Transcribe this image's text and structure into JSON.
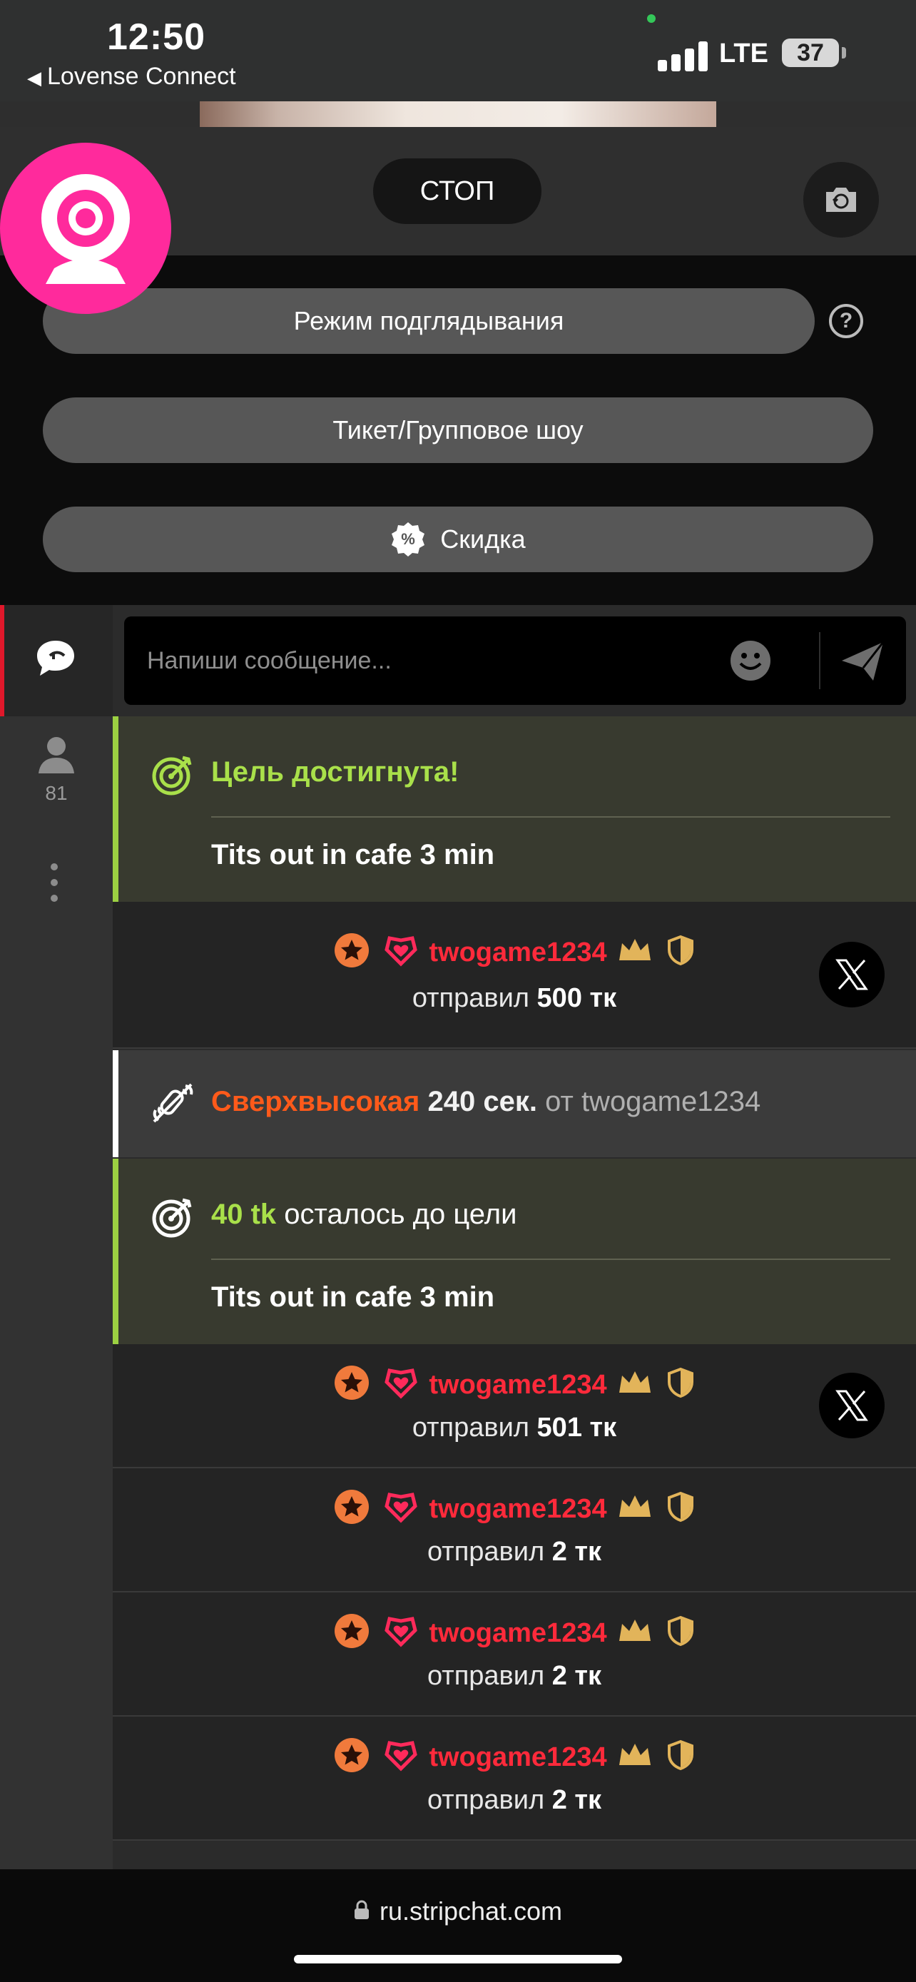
{
  "status_bar": {
    "time": "12:50",
    "back_label": "Lovense Connect",
    "network": "LTE",
    "battery": "37"
  },
  "controls": {
    "stop_label": "СТОП"
  },
  "options": {
    "peek_mode_label": "Режим подглядывания",
    "help_label": "?",
    "ticket_show_label": "Тикет/Групповое шоу",
    "discount_label": "Скидка",
    "discount_icon_text": "%"
  },
  "sidebar": {
    "user_count": "81"
  },
  "chat_input": {
    "placeholder": "Напиши сообщение..."
  },
  "messages": {
    "goal_reached": {
      "title": "Цель достигнута!",
      "goal_name": "Tits out in cafe 3 min"
    },
    "tip1": {
      "username": "twogame1234",
      "sent_label": "отправил",
      "amount": "500 тк"
    },
    "vibration": {
      "level": "Сверхвысокая",
      "duration": "240 сек.",
      "from_label": "от",
      "username": "twogame1234"
    },
    "goal_remaining": {
      "amount": "40 tk",
      "text": "осталось до цели",
      "goal_name": "Tits out in cafe 3 min"
    },
    "tip2": {
      "username": "twogame1234",
      "sent_label": "отправил",
      "amount": "501 тк"
    },
    "tip3": {
      "username": "twogame1234",
      "sent_label": "отправил",
      "amount": "2 тк"
    },
    "tip4": {
      "username": "twogame1234",
      "sent_label": "отправил",
      "amount": "2 тк"
    },
    "tip5": {
      "username": "twogame1234",
      "sent_label": "отправил",
      "amount": "2 тк"
    }
  },
  "url_bar": {
    "url": "ru.stripchat.com"
  },
  "colors": {
    "brand_pink": "#ff2a9c",
    "goal_lime": "#a9e04a",
    "username_red": "#ff2a3b",
    "vibration_orange": "#ff5a1a",
    "badge_gold": "#e2b45a"
  }
}
